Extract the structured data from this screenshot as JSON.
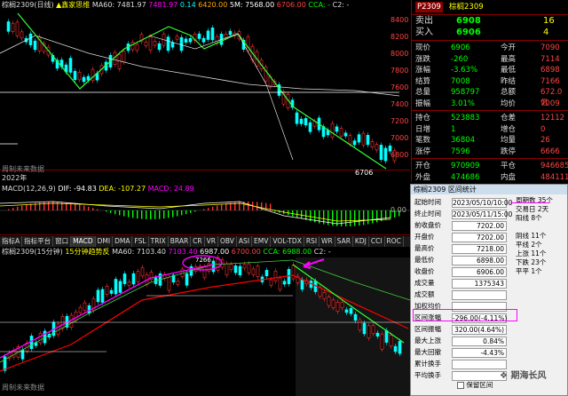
{
  "top": {
    "header": [
      "棕榈2309(日线)",
      "▲鑫家思维",
      "MA60: 7481.97",
      "7481.97",
      "0.14",
      "6420.00",
      "5M: 7568.00",
      "6706.00",
      "CCA: -",
      "CCA -",
      "CT -",
      "C2: -"
    ],
    "price_labels": [
      "8400",
      "8200",
      "8000",
      "7800",
      "7600",
      "7400",
      "7200",
      "7000",
      "6800"
    ],
    "annotations": {
      "low_label": "6706",
      "note": "周制未来数据"
    }
  },
  "year_label": "2022年",
  "macd": {
    "header": [
      "MACD(12,26,9)",
      "DIF: -94.83",
      "DEA: -107.27",
      "MACD: 24.89"
    ],
    "scale": [
      "0.00"
    ]
  },
  "ind_tabs": [
    "指标A",
    "指标平台",
    "窗口",
    "MACD",
    "DMI",
    "DMA",
    "FSL",
    "TRIX",
    "BRAR",
    "CR",
    "VR",
    "OBV",
    "ASI",
    "EMV",
    "VOL-TDX",
    "RSI",
    "WR",
    "SAR",
    "KDJ",
    "CCI",
    "ROC"
  ],
  "bottom": {
    "header": [
      "棕榈2309(15分钟)",
      "15分钟趋势反",
      "MA60: 7103.40",
      "7103.40",
      "6987.00",
      "6700.00",
      "CCA: 6988.00",
      "C2: -"
    ],
    "peak_label": "7266",
    "note": "周制未来数据"
  },
  "quote": {
    "title": "P2309",
    "name": "棕榈2309",
    "sell": {
      "label": "卖出",
      "price": "6908",
      "qty": "16"
    },
    "buy": {
      "label": "买入",
      "price": "6906",
      "qty": "4"
    },
    "rows": [
      {
        "l1": "现价",
        "v1": "6906",
        "l2": "今开",
        "v2": "7090"
      },
      {
        "l1": "涨跌",
        "v1": "-260",
        "l2": "最高",
        "v2": "7114"
      },
      {
        "l1": "涨幅",
        "v1": "-3.63%",
        "l2": "最低",
        "v2": "6898"
      },
      {
        "l1": "结算",
        "v1": "7008",
        "l2": "昨结",
        "v2": "7166"
      },
      {
        "l1": "总量",
        "v1": "958797",
        "l2": "总额",
        "v2": "672.0亿"
      },
      {
        "l1": "振幅",
        "v1": "3.01%",
        "l2": "均价",
        "v2": "7009"
      },
      {
        "l1": "持仓",
        "v1": "523883",
        "l2": "仓差",
        "v2": "12112"
      },
      {
        "l1": "日增",
        "v1": "1",
        "l2": "增仓",
        "v2": "0"
      },
      {
        "l1": "笔数",
        "v1": "36804",
        "l2": "均量",
        "v2": "26"
      },
      {
        "l1": "涨停",
        "v1": "7596",
        "l2": "跌停",
        "v2": "6666"
      },
      {
        "l1": "开仓",
        "v1": "970909",
        "l2": "平仓",
        "v2": "946685"
      },
      {
        "l1": "外盘",
        "v1": "474686",
        "l2": "内盘",
        "v2": "484111"
      }
    ]
  },
  "stats": {
    "title": "棕榈2309 区间统计",
    "rows": [
      {
        "label": "起始时间",
        "value": "2023/05/10/10:00"
      },
      {
        "label": "终止时间",
        "value": "2023/05/11/15:00"
      },
      {
        "label": "前收盘价",
        "value": "7202.00"
      },
      {
        "label": "开盘价",
        "value": "7202.00"
      },
      {
        "label": "最高价",
        "value": "7218.00"
      },
      {
        "label": "最低价",
        "value": "6898.00"
      },
      {
        "label": "收盘价",
        "value": "6906.00"
      },
      {
        "label": "成交量",
        "value": "1375343"
      },
      {
        "label": "成交额",
        "value": ""
      },
      {
        "label": "加权均价",
        "value": ""
      },
      {
        "label": "区间涨幅",
        "value": "-296.00(-4.11%)"
      },
      {
        "label": "区间振幅",
        "value": "320.00(4.64%)"
      },
      {
        "label": "最大上涨",
        "value": "0.84%"
      },
      {
        "label": "最大回撤",
        "value": "-4.43%"
      },
      {
        "label": "累计换手",
        "value": ""
      },
      {
        "label": "平均换手",
        "value": ""
      }
    ],
    "info": [
      "周期数 35个",
      "交易日 2天",
      "阳线 8个",
      "",
      "阴线 11个",
      "平线 2个",
      "上涨 11个",
      "下跌 23个",
      "平平 1个"
    ],
    "checkbox": "保留区间",
    "watermark": "期海长风"
  }
}
